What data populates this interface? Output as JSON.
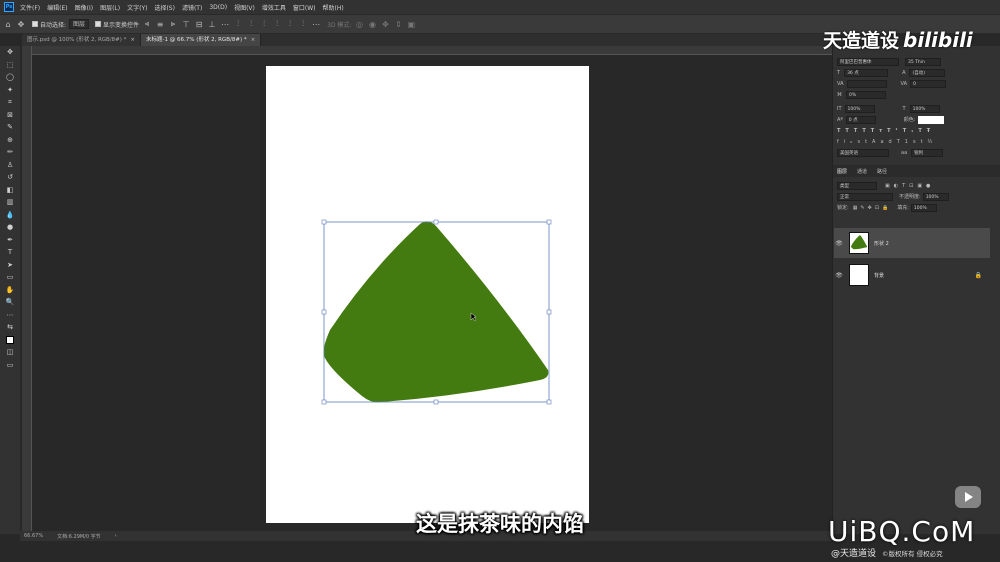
{
  "menubar": {
    "logo": "Ps",
    "items": [
      "文件(F)",
      "编辑(E)",
      "图像(I)",
      "图层(L)",
      "文字(Y)",
      "选择(S)",
      "滤镜(T)",
      "3D(D)",
      "视图(V)",
      "增效工具",
      "窗口(W)",
      "帮助(H)"
    ]
  },
  "optbar": {
    "auto_select": "自动选择:",
    "auto_select_value": "图层",
    "show_transform": "显示变换控件",
    "mode_3d": "3D 模式:"
  },
  "tabs": [
    {
      "label": "图示.psd @ 100% (形状 2, RGB/8#) *",
      "close": "×"
    },
    {
      "label": "未标题-1 @ 66.7% (形状 2, RGB/8#) *",
      "close": "×"
    }
  ],
  "status": {
    "zoom": "66.67%",
    "doc_info": "文档:6.29M/0 字节",
    "arrow": "›"
  },
  "character_panel": {
    "font_family": "阿里巴巴普惠体",
    "font_style": "35 Thin",
    "size": "36 点",
    "leading": "(自动)",
    "kerning": "",
    "tracking": "0",
    "tsume": "0%",
    "vscale": "100%",
    "hscale": "100%",
    "baseline": "0 点",
    "color_label": "颜色:",
    "lang": "美国英语",
    "aa_label": "aa",
    "aa": "锐利"
  },
  "layers_panel": {
    "tabs": [
      "图层",
      "通道",
      "路径"
    ],
    "filter": "类型",
    "blend": "正常",
    "opacity_label": "不透明度:",
    "opacity": "100%",
    "lock_label": "锁定:",
    "fill_label": "填充:",
    "fill": "100%",
    "layers": [
      {
        "name": "形状 2",
        "selected": true
      },
      {
        "name": "背景",
        "selected": false
      }
    ]
  },
  "overlay": {
    "channel_name": "天造道设",
    "bilibili": "bilibili",
    "subtitle": "这是抹茶味的内馅",
    "site": "UiBQ.CoM",
    "credit": "@天造道设",
    "rights": "©版权所有 侵权必究"
  },
  "colors": {
    "shape_fill": "#447b10",
    "bounding_box": "#5b7dbb",
    "canvas": "#ffffff"
  }
}
